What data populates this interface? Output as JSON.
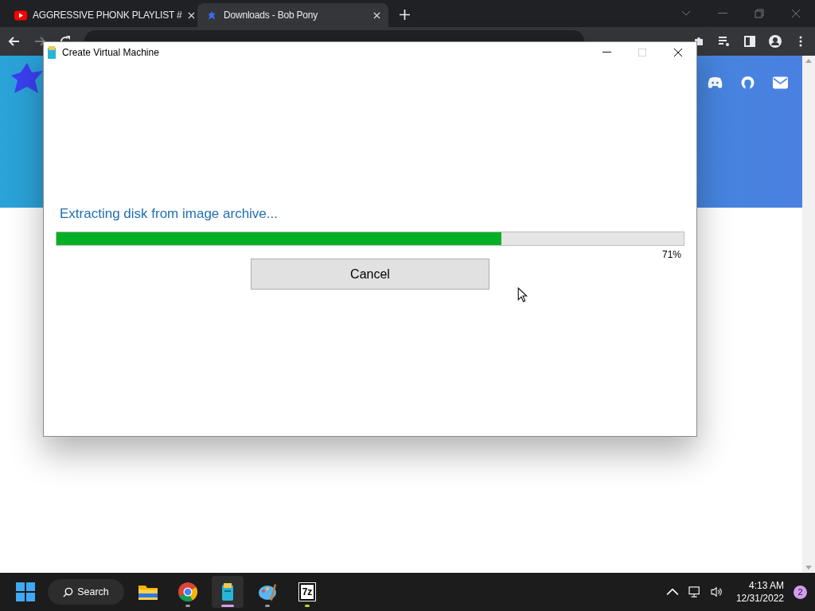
{
  "browser": {
    "tabs": [
      {
        "title": "AGGRESSIVE PHONK PLAYLIST #",
        "selected": false
      },
      {
        "title": "Downloads - Bob Pony",
        "selected": true
      }
    ]
  },
  "dialog": {
    "title": "Create Virtual Machine",
    "status": "Extracting disk from image archive...",
    "progress": {
      "level": 0.71,
      "reading": "71%"
    },
    "button": "Cancel"
  },
  "taskbar": {
    "search": "Search",
    "apps": [
      {
        "kind": "folder",
        "selected": false,
        "running": false
      },
      {
        "kind": "browser",
        "selected": false,
        "running": true
      },
      {
        "kind": "vm",
        "selected": true,
        "running": true
      },
      {
        "kind": "paint",
        "selected": false,
        "running": true
      },
      {
        "kind": "archiver",
        "label": "7z",
        "selected": false,
        "running": true
      }
    ],
    "time": "4:13 AM",
    "date": "12/31/2022",
    "badge": "2"
  }
}
